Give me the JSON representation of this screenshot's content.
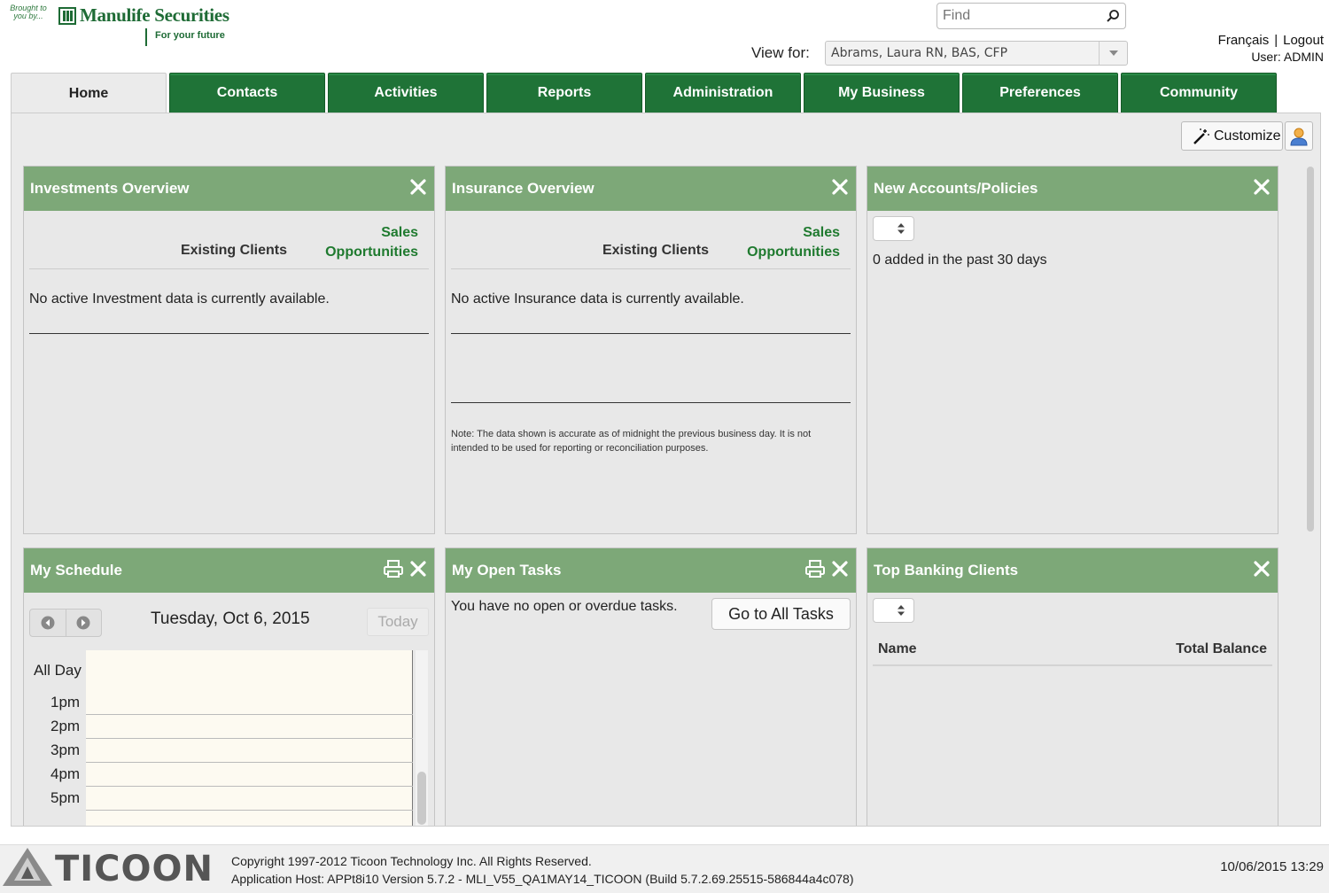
{
  "brand": {
    "brought_by": "Brought to you by...",
    "name": "Manulife Securities",
    "tagline": "For your future"
  },
  "header": {
    "find_placeholder": "Find",
    "view_for_label": "View for:",
    "view_for_value": "Abrams, Laura RN, BAS, CFP",
    "lang_link": "Français",
    "separator": "|",
    "logout_link": "Logout",
    "user_line": "User: ADMIN"
  },
  "tabs": [
    {
      "label": "Home",
      "active": true
    },
    {
      "label": "Contacts"
    },
    {
      "label": "Activities"
    },
    {
      "label": "Reports"
    },
    {
      "label": "Administration"
    },
    {
      "label": "My Business"
    },
    {
      "label": "Preferences"
    },
    {
      "label": "Community"
    }
  ],
  "toolbar": {
    "customize_label": "Customize"
  },
  "widgets": {
    "investments": {
      "title": "Investments Overview",
      "col_existing": "Existing Clients",
      "col_sales_1": "Sales",
      "col_sales_2": "Opportunities",
      "message": "No active Investment data is currently available."
    },
    "insurance": {
      "title": "Insurance Overview",
      "col_existing": "Existing Clients",
      "col_sales_1": "Sales",
      "col_sales_2": "Opportunities",
      "message": "No active Insurance data is currently available.",
      "note": "Note: The data shown is accurate as of midnight the previous business day. It is not intended to be used for reporting or reconciliation purposes."
    },
    "new_accounts": {
      "title": "New Accounts/Policies",
      "summary": "0 added in the past 30 days"
    },
    "schedule": {
      "title": "My Schedule",
      "date": "Tuesday, Oct 6, 2015",
      "today_label": "Today",
      "all_day_label": "All Day",
      "hours": [
        "1pm",
        "2pm",
        "3pm",
        "4pm",
        "5pm"
      ]
    },
    "tasks": {
      "title": "My Open Tasks",
      "message": "You have no open or overdue tasks.",
      "button": "Go to All Tasks"
    },
    "banking": {
      "title": "Top Banking Clients",
      "col_name": "Name",
      "col_balance": "Total Balance"
    }
  },
  "footer": {
    "logo_text": "TICOON",
    "copyright": "Copyright 1997-2012 Ticoon Technology Inc. All Rights Reserved.",
    "app_host": "Application Host: APPt8i10 Version 5.7.2 - MLI_V55_QA1MAY14_TICOON (Build 5.7.2.69.25515-586844a4c078)",
    "timestamp": "10/06/2015 13:29"
  },
  "colors": {
    "tab_green": "#1f7337",
    "widget_header": "#7da878",
    "sales_green": "#1f7a2f"
  }
}
